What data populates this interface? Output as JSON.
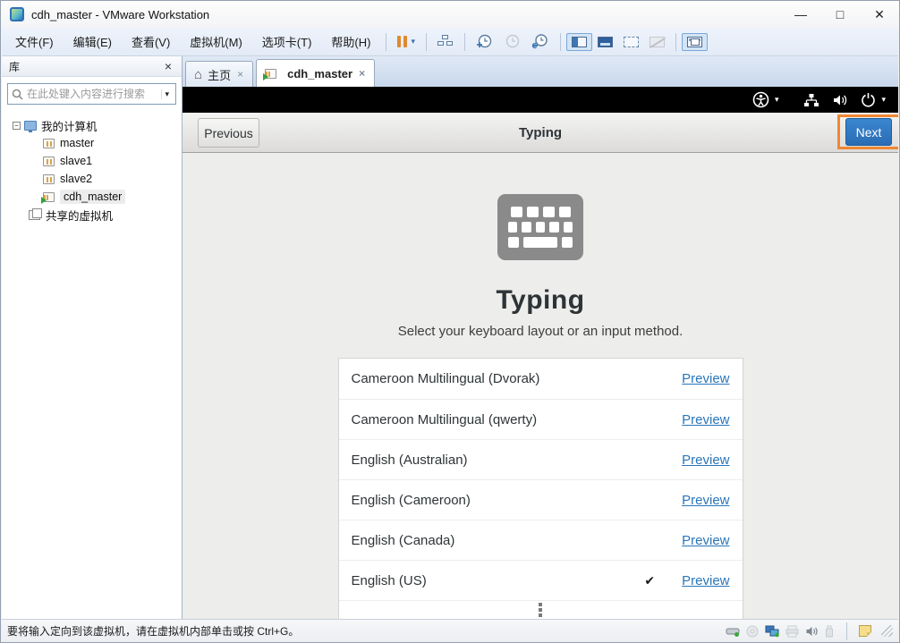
{
  "window": {
    "title": "cdh_master - VMware Workstation",
    "minimize_glyph": "—",
    "maximize_glyph": "□",
    "close_glyph": "✕"
  },
  "menubar": {
    "items": [
      "文件(F)",
      "编辑(E)",
      "查看(V)",
      "虚拟机(M)",
      "选项卡(T)",
      "帮助(H)"
    ]
  },
  "toolbar": {
    "caret_glyph": "▾",
    "icons": [
      "suspend",
      "send-ctrl-alt-del",
      "take-snapshot",
      "revert-snapshot",
      "snapshot-manager",
      "show-library",
      "show-thumbnail-bar",
      "fullscreen",
      "unity-mode",
      "show-console-view"
    ]
  },
  "sidebar": {
    "title": "库",
    "close_glyph": "×",
    "search_placeholder": "在此处键入内容进行搜索",
    "search_caret": "▾",
    "expander_glyph": "−",
    "tree": {
      "root": "我的计算机",
      "vms": [
        {
          "name": "master",
          "state": "off"
        },
        {
          "name": "slave1",
          "state": "off"
        },
        {
          "name": "slave2",
          "state": "off"
        },
        {
          "name": "cdh_master",
          "state": "running"
        }
      ],
      "shared": "共享的虚拟机"
    }
  },
  "tabs": [
    {
      "label": "主页",
      "close_glyph": "×",
      "home_glyph": "⌂"
    },
    {
      "label": "cdh_master",
      "close_glyph": "×"
    }
  ],
  "vm": {
    "wizard": {
      "previous_label": "Previous",
      "bar_title": "Typing",
      "next_label": "Next",
      "heading": "Typing",
      "subtitle": "Select your keyboard layout or an input method.",
      "preview_label": "Preview",
      "check_glyph": "✔",
      "layouts": [
        {
          "name": "Cameroon Multilingual (Dvorak)",
          "selected": false
        },
        {
          "name": "Cameroon Multilingual (qwerty)",
          "selected": false
        },
        {
          "name": "English (Australian)",
          "selected": false
        },
        {
          "name": "English (Cameroon)",
          "selected": false
        },
        {
          "name": "English (Canada)",
          "selected": false
        },
        {
          "name": "English (US)",
          "selected": true
        }
      ]
    }
  },
  "statusbar": {
    "message": "要将输入定向到该虚拟机，请在虚拟机内部单击或按 Ctrl+G。"
  },
  "colors": {
    "accent_blue": "#2a6cb4",
    "highlight_orange": "#ef8733",
    "link_blue": "#2a76b8",
    "suspend_orange": "#e0892e"
  }
}
